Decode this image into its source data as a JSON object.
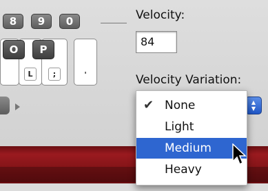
{
  "keys": {
    "row1": [
      "8",
      "9",
      "0"
    ],
    "row2": [
      "O",
      "P"
    ],
    "row3": [
      "L",
      ";",
      "'"
    ]
  },
  "velocity": {
    "label": "Velocity:",
    "value": "84"
  },
  "velocity_variation": {
    "label": "Velocity Variation:",
    "options": [
      "None",
      "Light",
      "Medium",
      "Heavy"
    ],
    "checked": "None",
    "highlighted": "Medium"
  },
  "colors": {
    "highlight": "#2e66d0",
    "band": "#8a161a"
  }
}
